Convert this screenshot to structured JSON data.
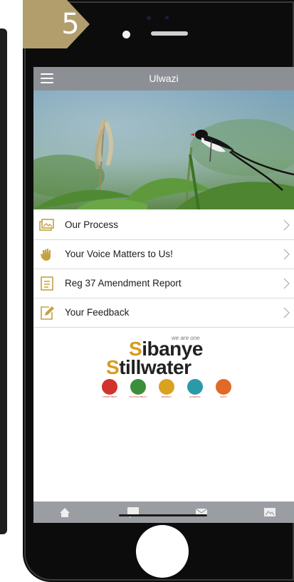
{
  "badge": {
    "number": "5"
  },
  "app": {
    "title": "Ulwazi"
  },
  "menu": {
    "items": [
      {
        "label": "Our Process",
        "icon": "photos-icon"
      },
      {
        "label": "Your Voice Matters to Us!",
        "icon": "hand-icon"
      },
      {
        "label": "Reg 37 Amendment Report",
        "icon": "document-icon"
      },
      {
        "label": "Your Feedback",
        "icon": "edit-icon"
      }
    ]
  },
  "logo": {
    "tagline": "we are one",
    "line1": "ibanye",
    "line1_initial": "S",
    "line2": "tillwater",
    "line2_initial": "S",
    "values": [
      {
        "label": "COMMITMENT",
        "color": "#d0342c"
      },
      {
        "label": "ACCOUNTABILITY",
        "color": "#3b8f3a"
      },
      {
        "label": "RESPECT",
        "color": "#d9a21f"
      },
      {
        "label": "ENABLING",
        "color": "#2a9aa8"
      },
      {
        "label": "HAPPY",
        "color": "#e06a26"
      }
    ]
  },
  "tabbar": {
    "tabs": [
      "home-icon",
      "chat-icon",
      "mail-icon",
      "gallery-icon"
    ]
  },
  "colors": {
    "topbar": "#8c9094",
    "tabbar": "#9a9ea2",
    "badge": "#b29d6c",
    "icon_accent": "#c4a23e"
  }
}
